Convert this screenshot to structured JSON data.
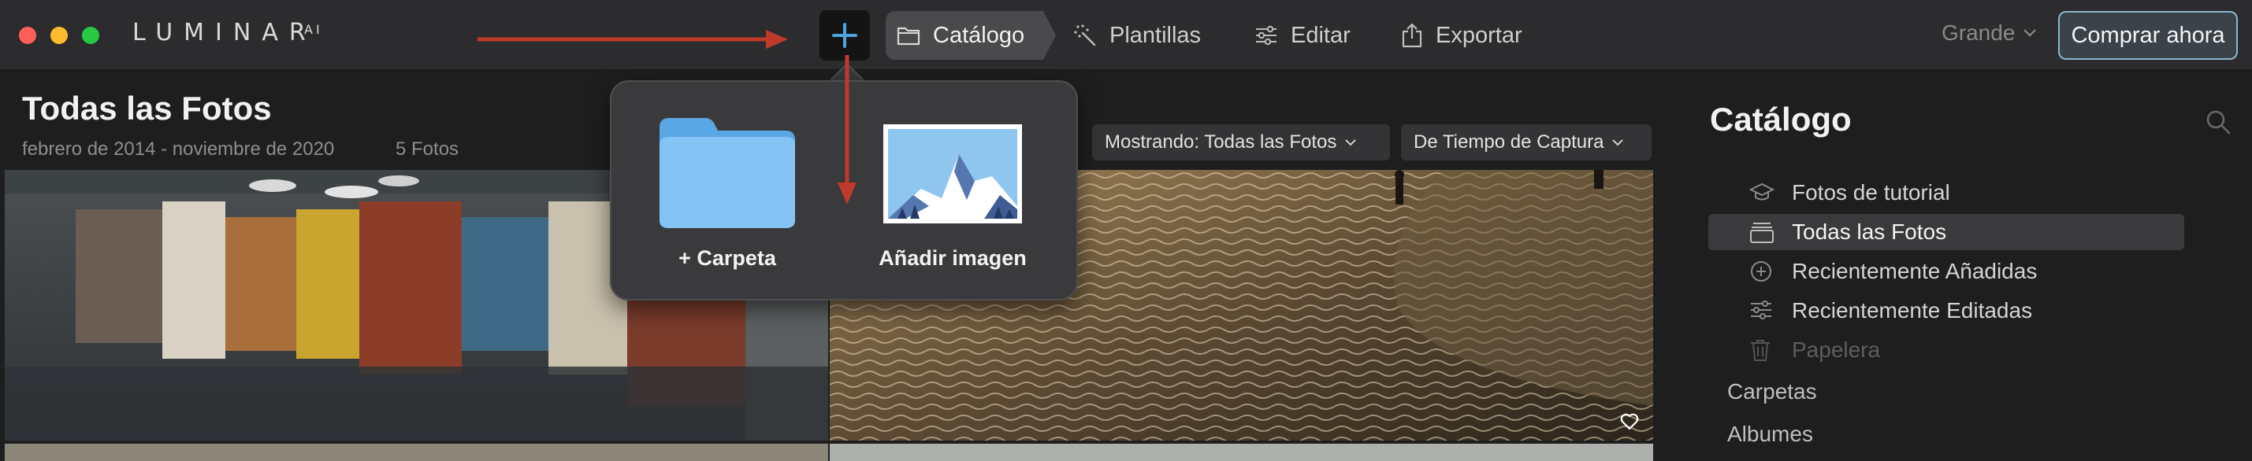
{
  "app": {
    "logo_text": "LUMINAR",
    "logo_suffix": "AI"
  },
  "toolbar": {
    "add_icon": "plus-icon",
    "nav": [
      {
        "label": "Catálogo",
        "icon": "folder-icon",
        "active": true
      },
      {
        "label": "Plantillas",
        "icon": "magic-wand-icon"
      },
      {
        "label": "Editar",
        "icon": "sliders-icon"
      },
      {
        "label": "Exportar",
        "icon": "share-icon"
      }
    ],
    "size_label": "Grande",
    "buy_label": "Comprar ahora"
  },
  "gallery": {
    "title": "Todas las Fotos",
    "date_range": "febrero de 2014 - noviembre de 2020",
    "photo_count": "5 Fotos",
    "filter_label": "Mostrando: Todas las Fotos",
    "sort_label": "De Tiempo de Captura"
  },
  "add_popover": {
    "folder_label": "+ Carpeta",
    "image_label": "Añadir imagen"
  },
  "sidebar": {
    "title": "Catálogo",
    "items": [
      {
        "label": "Fotos de tutorial",
        "icon": "graduation-cap-icon"
      },
      {
        "label": "Todas las Fotos",
        "icon": "stack-icon",
        "active": true
      },
      {
        "label": "Recientemente Añadidas",
        "icon": "plus-circle-icon"
      },
      {
        "label": "Recientemente Editadas",
        "icon": "sliders-icon"
      },
      {
        "label": "Papelera",
        "icon": "trash-icon",
        "disabled": true
      }
    ],
    "sections": [
      "Carpetas",
      "Albumes"
    ]
  },
  "colors": {
    "annotation_arrow": "#c0392b",
    "accent_blue": "#4fa3e0",
    "buy_border": "#8ab8cf"
  }
}
